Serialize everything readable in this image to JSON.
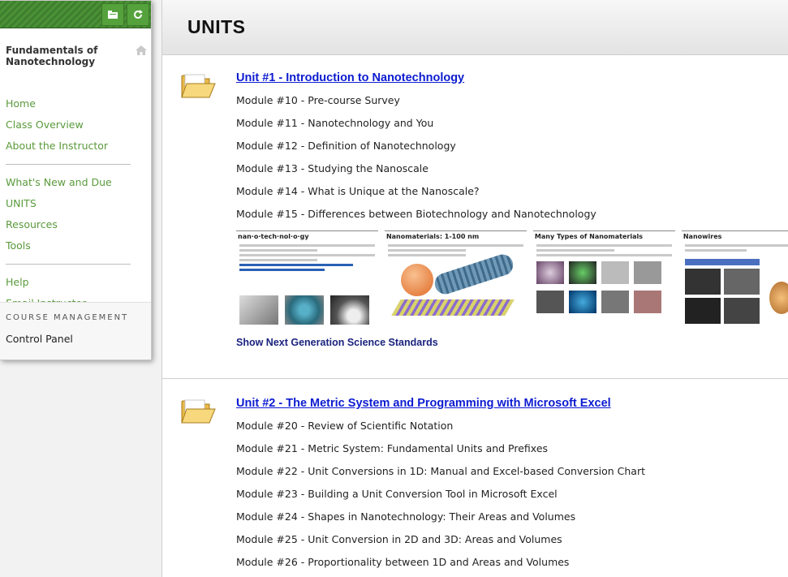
{
  "sidebar": {
    "course_title": "Fundamentals of Nanotechnology",
    "menu_group1": [
      "Home",
      "Class Overview",
      "About the Instructor"
    ],
    "menu_group2": [
      "What's New and Due",
      "UNITS",
      "Resources",
      "Tools"
    ],
    "menu_group3": [
      "Help",
      "Email Instructor"
    ],
    "course_management_heading": "COURSE MANAGEMENT",
    "control_panel_label": "Control Panel"
  },
  "page": {
    "title": "UNITS"
  },
  "units": [
    {
      "title": "Unit #1 - Introduction to Nanotechnology",
      "modules": [
        "Module #10 - Pre-course Survey",
        "Module #11 - Nanotechnology and You",
        "Module #12 - Definition of Nanotechnology",
        "Module #13 - Studying the Nanoscale",
        "Module #14 - What is Unique at the Nanoscale?",
        "Module #15 - Differences between Biotechnology and Nanotechnology"
      ],
      "thumbnails": [
        {
          "title": "nan·o·tech·nol·o·gy"
        },
        {
          "title": "Nanomaterials: 1-100 nm"
        },
        {
          "title": "Many Types of Nanomaterials"
        },
        {
          "title": "Nanowires"
        }
      ],
      "standards_link": "Show Next Generation Science Standards"
    },
    {
      "title": "Unit #2 - The Metric System and Programming with Microsoft Excel",
      "modules": [
        "Module #20 - Review of Scientific Notation",
        "Module #21 - Metric System: Fundamental Units and Prefixes",
        "Module #22 - Unit Conversions in 1D: Manual and Excel-based Conversion Chart",
        "Module #23 - Building a Unit Conversion Tool in Microsoft Excel",
        "Module #24 - Shapes in Nanotechnology: Their Areas and Volumes",
        "Module #25 - Unit Conversion in 2D and 3D: Areas and Volumes",
        "Module #26 - Proportionality between 1D and Areas and Volumes"
      ]
    }
  ],
  "colors": {
    "accent_green": "#4b9237",
    "link_blue": "#0c1bd0",
    "menu_green": "#5a9a3c"
  },
  "icons": [
    "folder-icon",
    "refresh-icon",
    "home-icon",
    "open-folder-icon"
  ]
}
